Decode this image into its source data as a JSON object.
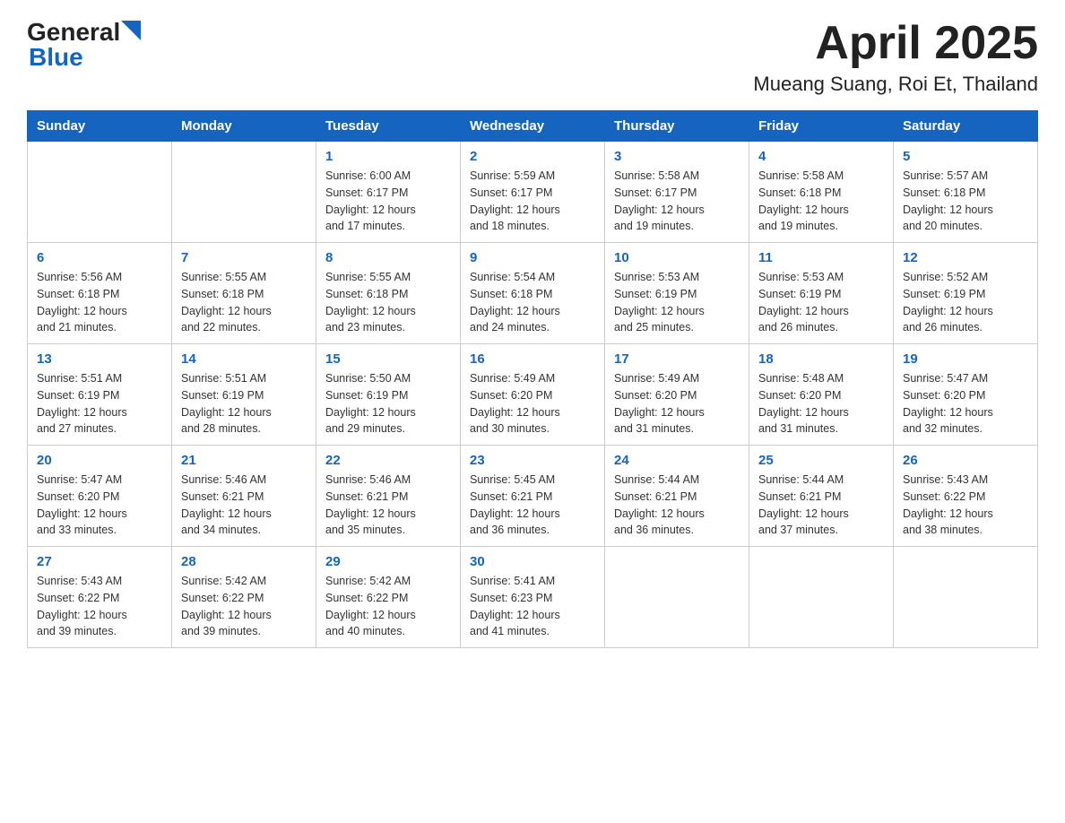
{
  "header": {
    "logo_general": "General",
    "logo_blue": "Blue",
    "month_title": "April 2025",
    "location": "Mueang Suang, Roi Et, Thailand"
  },
  "weekdays": [
    "Sunday",
    "Monday",
    "Tuesday",
    "Wednesday",
    "Thursday",
    "Friday",
    "Saturday"
  ],
  "weeks": [
    [
      {
        "day": "",
        "info": ""
      },
      {
        "day": "",
        "info": ""
      },
      {
        "day": "1",
        "info": "Sunrise: 6:00 AM\nSunset: 6:17 PM\nDaylight: 12 hours\nand 17 minutes."
      },
      {
        "day": "2",
        "info": "Sunrise: 5:59 AM\nSunset: 6:17 PM\nDaylight: 12 hours\nand 18 minutes."
      },
      {
        "day": "3",
        "info": "Sunrise: 5:58 AM\nSunset: 6:17 PM\nDaylight: 12 hours\nand 19 minutes."
      },
      {
        "day": "4",
        "info": "Sunrise: 5:58 AM\nSunset: 6:18 PM\nDaylight: 12 hours\nand 19 minutes."
      },
      {
        "day": "5",
        "info": "Sunrise: 5:57 AM\nSunset: 6:18 PM\nDaylight: 12 hours\nand 20 minutes."
      }
    ],
    [
      {
        "day": "6",
        "info": "Sunrise: 5:56 AM\nSunset: 6:18 PM\nDaylight: 12 hours\nand 21 minutes."
      },
      {
        "day": "7",
        "info": "Sunrise: 5:55 AM\nSunset: 6:18 PM\nDaylight: 12 hours\nand 22 minutes."
      },
      {
        "day": "8",
        "info": "Sunrise: 5:55 AM\nSunset: 6:18 PM\nDaylight: 12 hours\nand 23 minutes."
      },
      {
        "day": "9",
        "info": "Sunrise: 5:54 AM\nSunset: 6:18 PM\nDaylight: 12 hours\nand 24 minutes."
      },
      {
        "day": "10",
        "info": "Sunrise: 5:53 AM\nSunset: 6:19 PM\nDaylight: 12 hours\nand 25 minutes."
      },
      {
        "day": "11",
        "info": "Sunrise: 5:53 AM\nSunset: 6:19 PM\nDaylight: 12 hours\nand 26 minutes."
      },
      {
        "day": "12",
        "info": "Sunrise: 5:52 AM\nSunset: 6:19 PM\nDaylight: 12 hours\nand 26 minutes."
      }
    ],
    [
      {
        "day": "13",
        "info": "Sunrise: 5:51 AM\nSunset: 6:19 PM\nDaylight: 12 hours\nand 27 minutes."
      },
      {
        "day": "14",
        "info": "Sunrise: 5:51 AM\nSunset: 6:19 PM\nDaylight: 12 hours\nand 28 minutes."
      },
      {
        "day": "15",
        "info": "Sunrise: 5:50 AM\nSunset: 6:19 PM\nDaylight: 12 hours\nand 29 minutes."
      },
      {
        "day": "16",
        "info": "Sunrise: 5:49 AM\nSunset: 6:20 PM\nDaylight: 12 hours\nand 30 minutes."
      },
      {
        "day": "17",
        "info": "Sunrise: 5:49 AM\nSunset: 6:20 PM\nDaylight: 12 hours\nand 31 minutes."
      },
      {
        "day": "18",
        "info": "Sunrise: 5:48 AM\nSunset: 6:20 PM\nDaylight: 12 hours\nand 31 minutes."
      },
      {
        "day": "19",
        "info": "Sunrise: 5:47 AM\nSunset: 6:20 PM\nDaylight: 12 hours\nand 32 minutes."
      }
    ],
    [
      {
        "day": "20",
        "info": "Sunrise: 5:47 AM\nSunset: 6:20 PM\nDaylight: 12 hours\nand 33 minutes."
      },
      {
        "day": "21",
        "info": "Sunrise: 5:46 AM\nSunset: 6:21 PM\nDaylight: 12 hours\nand 34 minutes."
      },
      {
        "day": "22",
        "info": "Sunrise: 5:46 AM\nSunset: 6:21 PM\nDaylight: 12 hours\nand 35 minutes."
      },
      {
        "day": "23",
        "info": "Sunrise: 5:45 AM\nSunset: 6:21 PM\nDaylight: 12 hours\nand 36 minutes."
      },
      {
        "day": "24",
        "info": "Sunrise: 5:44 AM\nSunset: 6:21 PM\nDaylight: 12 hours\nand 36 minutes."
      },
      {
        "day": "25",
        "info": "Sunrise: 5:44 AM\nSunset: 6:21 PM\nDaylight: 12 hours\nand 37 minutes."
      },
      {
        "day": "26",
        "info": "Sunrise: 5:43 AM\nSunset: 6:22 PM\nDaylight: 12 hours\nand 38 minutes."
      }
    ],
    [
      {
        "day": "27",
        "info": "Sunrise: 5:43 AM\nSunset: 6:22 PM\nDaylight: 12 hours\nand 39 minutes."
      },
      {
        "day": "28",
        "info": "Sunrise: 5:42 AM\nSunset: 6:22 PM\nDaylight: 12 hours\nand 39 minutes."
      },
      {
        "day": "29",
        "info": "Sunrise: 5:42 AM\nSunset: 6:22 PM\nDaylight: 12 hours\nand 40 minutes."
      },
      {
        "day": "30",
        "info": "Sunrise: 5:41 AM\nSunset: 6:23 PM\nDaylight: 12 hours\nand 41 minutes."
      },
      {
        "day": "",
        "info": ""
      },
      {
        "day": "",
        "info": ""
      },
      {
        "day": "",
        "info": ""
      }
    ]
  ]
}
